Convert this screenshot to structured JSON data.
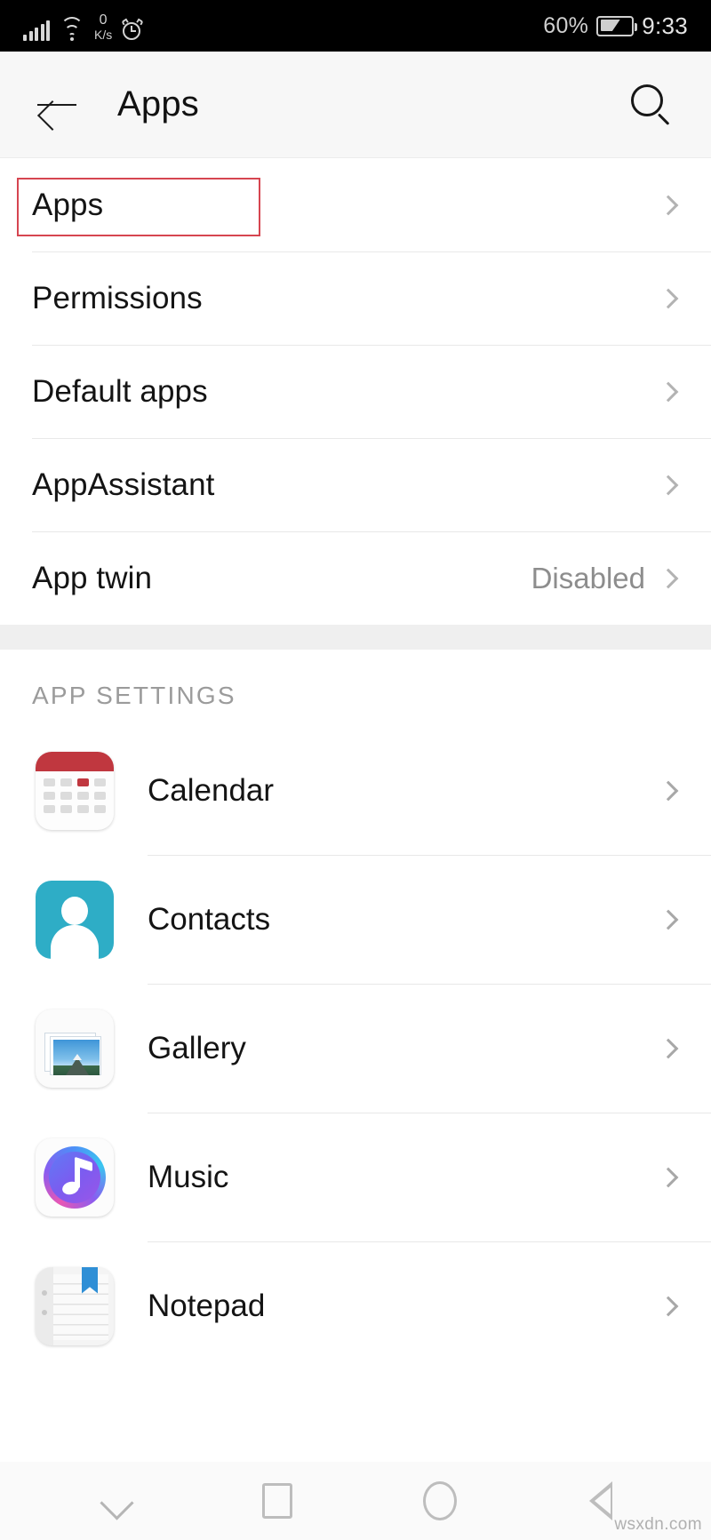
{
  "status_bar": {
    "network_speed_value": "0",
    "network_speed_unit": "K/s",
    "battery_percent": "60%",
    "time": "9:33",
    "icons": [
      "signal-icon",
      "wifi-icon",
      "network-speed-icon",
      "alarm-icon",
      "battery-icon"
    ]
  },
  "app_bar": {
    "back_label": "back-arrow-icon",
    "title": "Apps",
    "search_label": "search-icon"
  },
  "settings_rows": [
    {
      "label": "Apps",
      "value": "",
      "highlighted": true
    },
    {
      "label": "Permissions",
      "value": ""
    },
    {
      "label": "Default apps",
      "value": ""
    },
    {
      "label": "AppAssistant",
      "value": ""
    },
    {
      "label": "App twin",
      "value": "Disabled"
    }
  ],
  "section": {
    "title": "APP SETTINGS"
  },
  "app_rows": [
    {
      "label": "Calendar",
      "icon": "calendar-icon"
    },
    {
      "label": "Contacts",
      "icon": "contacts-icon"
    },
    {
      "label": "Gallery",
      "icon": "gallery-icon"
    },
    {
      "label": "Music",
      "icon": "music-icon"
    },
    {
      "label": "Notepad",
      "icon": "notepad-icon"
    }
  ],
  "nav_bar": {
    "items": [
      "chevron-down-icon",
      "recents-square-icon",
      "home-circle-icon",
      "back-triangle-icon"
    ]
  },
  "watermark": "wsxdn.com",
  "colors": {
    "status_bar_bg": "#000000",
    "app_bar_bg": "#f7f7f7",
    "highlight_box": "#d64550",
    "calendar_red": "#c0373f",
    "contacts_cyan": "#2eadc6",
    "notepad_blue": "#2f8fd6",
    "divider": "#e8e8e8",
    "secondary_text": "#8d8d8d"
  }
}
